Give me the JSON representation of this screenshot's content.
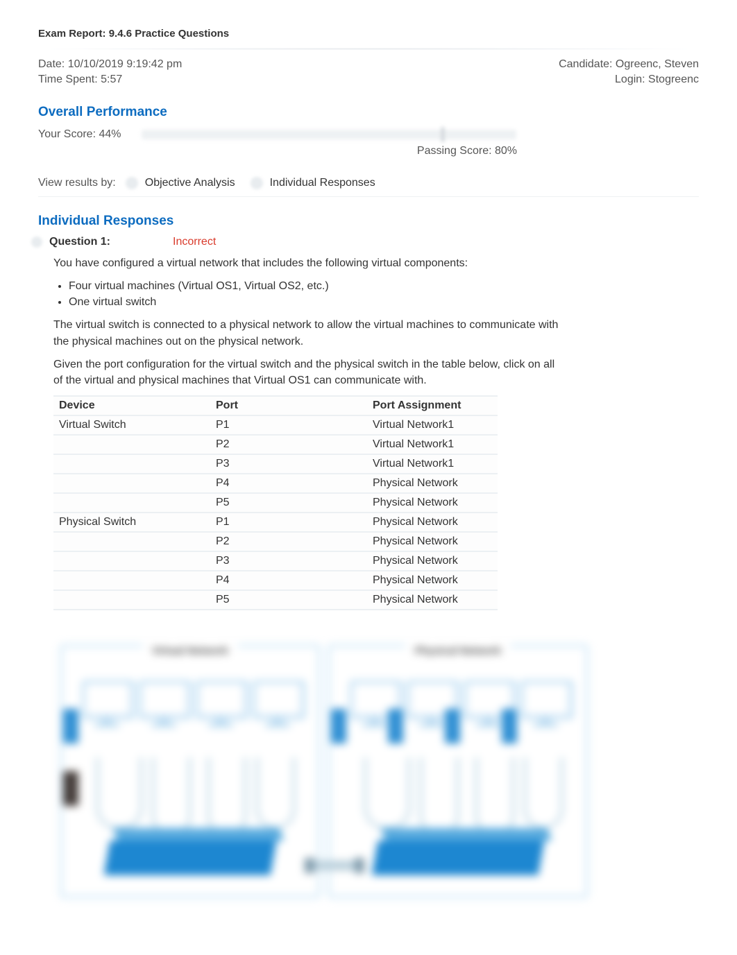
{
  "report": {
    "title": "Exam Report: 9.4.6 Practice Questions",
    "date_label": "Date: 10/10/2019 9:19:42 pm",
    "time_spent_label": "Time Spent: 5:57",
    "candidate_label": "Candidate: Ogreenc, Steven",
    "login_label": "Login: Stogreenc"
  },
  "performance": {
    "heading": "Overall Performance",
    "your_score_label": "Your Score: 44%",
    "score_percent": 44,
    "passing_score_label": "Passing Score: 80%",
    "passing_score_percent": 80
  },
  "filters": {
    "label": "View results by:",
    "option_objective": "Objective Analysis",
    "option_individual": "Individual Responses"
  },
  "responses": {
    "heading": "Individual Responses"
  },
  "question1": {
    "number_label": "Question 1:",
    "status": "Incorrect",
    "intro": "You have configured a virtual network that includes the following virtual components:",
    "bullets": [
      "Four virtual machines (Virtual OS1, Virtual OS2, etc.)",
      "One virtual switch"
    ],
    "para2": "The virtual switch is connected to a physical network to allow the virtual machines to communicate with the physical machines out on the physical network.",
    "para3": "Given the port configuration for the virtual switch and the physical switch in the table below, click on all of the virtual and physical machines that Virtual OS1 can communicate with.",
    "table": {
      "headers": {
        "device": "Device",
        "port": "Port",
        "assignment": "Port Assignment"
      },
      "rows": [
        {
          "device": "Virtual Switch",
          "port": "P1",
          "assignment": "Virtual Network1"
        },
        {
          "device": "",
          "port": "P2",
          "assignment": "Virtual Network1"
        },
        {
          "device": "",
          "port": "P3",
          "assignment": "Virtual Network1"
        },
        {
          "device": "",
          "port": "P4",
          "assignment": "Physical Network"
        },
        {
          "device": "",
          "port": "P5",
          "assignment": "Physical Network"
        },
        {
          "device": "Physical Switch",
          "port": "P1",
          "assignment": "Physical Network"
        },
        {
          "device": "",
          "port": "P2",
          "assignment": "Physical Network"
        },
        {
          "device": "",
          "port": "P3",
          "assignment": "Physical Network"
        },
        {
          "device": "",
          "port": "P4",
          "assignment": "Physical Network"
        },
        {
          "device": "",
          "port": "P5",
          "assignment": "Physical Network"
        }
      ]
    }
  },
  "diagram": {
    "left_title": "Virtual Network",
    "right_title": "Physical Network"
  }
}
